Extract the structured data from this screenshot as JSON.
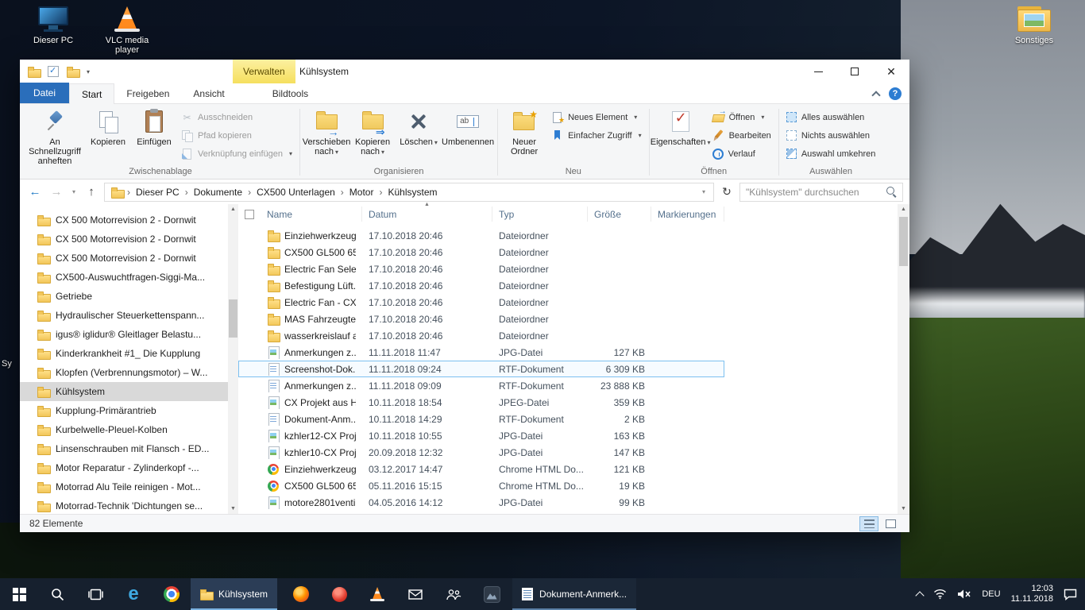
{
  "desktop": {
    "icons": [
      {
        "id": "dieser-pc",
        "label": "Dieser PC"
      },
      {
        "id": "vlc",
        "label": "VLC media player"
      },
      {
        "id": "sonstiges",
        "label": "Sonstiges"
      }
    ],
    "partial_label": "Sy"
  },
  "explorer": {
    "title": "Kühlsystem",
    "contextual_group": "Verwalten",
    "tabs": {
      "datei": "Datei",
      "start": "Start",
      "freigeben": "Freigeben",
      "ansicht": "Ansicht",
      "bildtools": "Bildtools"
    },
    "ribbon": {
      "pin_label": "An Schnellzugriff anheften",
      "copy": "Kopieren",
      "paste": "Einfügen",
      "cut": "Ausschneiden",
      "copy_path": "Pfad kopieren",
      "paste_shortcut": "Verknüpfung einfügen",
      "grp_clipboard": "Zwischenablage",
      "move_to": "Verschieben nach",
      "copy_to": "Kopieren nach",
      "delete": "Löschen",
      "rename": "Umbenennen",
      "grp_organize": "Organisieren",
      "new_folder": "Neuer Ordner",
      "new_item": "Neues Element",
      "easy_access": "Einfacher Zugriff",
      "grp_new": "Neu",
      "properties": "Eigenschaften",
      "open": "Öffnen",
      "edit": "Bearbeiten",
      "history": "Verlauf",
      "grp_open": "Öffnen",
      "select_all": "Alles auswählen",
      "select_none": "Nichts auswählen",
      "invert_selection": "Auswahl umkehren",
      "grp_select": "Auswählen"
    },
    "nav": {
      "breadcrumb": [
        "Dieser PC",
        "Dokumente",
        "CX500 Unterlagen",
        "Motor",
        "Kühlsystem"
      ],
      "search_placeholder": "\"Kühlsystem\" durchsuchen"
    },
    "tree": [
      {
        "label": "CX 500 Motorrevision 2 - Dornwit"
      },
      {
        "label": "CX 500 Motorrevision 2 - Dornwit"
      },
      {
        "label": "CX 500 Motorrevision 2 - Dornwit"
      },
      {
        "label": "CX500-Auswuchtfragen-Siggi-Ma..."
      },
      {
        "label": "Getriebe"
      },
      {
        "label": "Hydraulischer Steuerkettenspann..."
      },
      {
        "label": "igus® iglidur® Gleitlager Belastu..."
      },
      {
        "label": "Kinderkrankheit #1_ Die Kupplung"
      },
      {
        "label": "Klopfen (Verbrennungsmotor) – W..."
      },
      {
        "label": "Kühlsystem",
        "selected": true
      },
      {
        "label": "Kupplung-Primärantrieb"
      },
      {
        "label": "Kurbelwelle-Pleuel-Kolben"
      },
      {
        "label": "Linsenschrauben mit Flansch - ED..."
      },
      {
        "label": "Motor Reparatur - Zylinderkopf -..."
      },
      {
        "label": "Motorrad Alu Teile reinigen - Mot..."
      },
      {
        "label": "Motorrad-Technik 'Dichtungen se..."
      }
    ],
    "list": {
      "columns": {
        "name": "Name",
        "date": "Datum",
        "type": "Typ",
        "size": "Größe",
        "tags": "Markierungen"
      },
      "rows": [
        {
          "name": "Einziehwerkzeug ...",
          "date": "17.10.2018 20:46",
          "type": "Dateiordner",
          "size": "",
          "icon": "folder"
        },
        {
          "name": "CX500 GL500 650...",
          "date": "17.10.2018 20:46",
          "type": "Dateiordner",
          "size": "",
          "icon": "folder"
        },
        {
          "name": "Electric Fan Selec...",
          "date": "17.10.2018 20:46",
          "type": "Dateiordner",
          "size": "",
          "icon": "folder"
        },
        {
          "name": "Befestigung Lüft...",
          "date": "17.10.2018 20:46",
          "type": "Dateiordner",
          "size": "",
          "icon": "folder"
        },
        {
          "name": "Electric Fan - CX...",
          "date": "17.10.2018 20:46",
          "type": "Dateiordner",
          "size": "",
          "icon": "folder"
        },
        {
          "name": "MAS Fahrzeugte...",
          "date": "17.10.2018 20:46",
          "type": "Dateiordner",
          "size": "",
          "icon": "folder"
        },
        {
          "name": "wasserkreislauf a...",
          "date": "17.10.2018 20:46",
          "type": "Dateiordner",
          "size": "",
          "icon": "folder"
        },
        {
          "name": "Anmerkungen z...",
          "date": "11.11.2018 11:47",
          "type": "JPG-Datei",
          "size": "127 KB",
          "icon": "image"
        },
        {
          "name": "Screenshot-Dok...",
          "date": "11.11.2018 09:24",
          "type": "RTF-Dokument",
          "size": "6 309 KB",
          "icon": "rtf",
          "selected": true
        },
        {
          "name": "Anmerkungen z...",
          "date": "11.11.2018 09:09",
          "type": "RTF-Dokument",
          "size": "23 888 KB",
          "icon": "rtf"
        },
        {
          "name": "CX Projekt aus H...",
          "date": "10.11.2018 18:54",
          "type": "JPEG-Datei",
          "size": "359 KB",
          "icon": "image"
        },
        {
          "name": "Dokument-Anm...",
          "date": "10.11.2018 14:29",
          "type": "RTF-Dokument",
          "size": "2 KB",
          "icon": "rtf"
        },
        {
          "name": "kzhler12-CX Proj...",
          "date": "10.11.2018 10:55",
          "type": "JPG-Datei",
          "size": "163 KB",
          "icon": "image"
        },
        {
          "name": "kzhler10-CX Proj...",
          "date": "20.09.2018 12:32",
          "type": "JPG-Datei",
          "size": "147 KB",
          "icon": "image"
        },
        {
          "name": "Einziehwerkzeug ...",
          "date": "03.12.2017 14:47",
          "type": "Chrome HTML Do...",
          "size": "121 KB",
          "icon": "chrome"
        },
        {
          "name": "CX500 GL500 650...",
          "date": "05.11.2016 15:15",
          "type": "Chrome HTML Do...",
          "size": "19 KB",
          "icon": "chrome"
        },
        {
          "name": "motore2801venti...",
          "date": "04.05.2016 14:12",
          "type": "JPG-Datei",
          "size": "99 KB",
          "icon": "image"
        }
      ]
    },
    "status": {
      "count": "82 Elemente"
    }
  },
  "taskbar": {
    "task1": "Kühlsystem",
    "task2": "Dokument-Anmerk...",
    "tray": {
      "lang": "DEU",
      "time": "12:03",
      "date": "11.11.2018"
    }
  }
}
